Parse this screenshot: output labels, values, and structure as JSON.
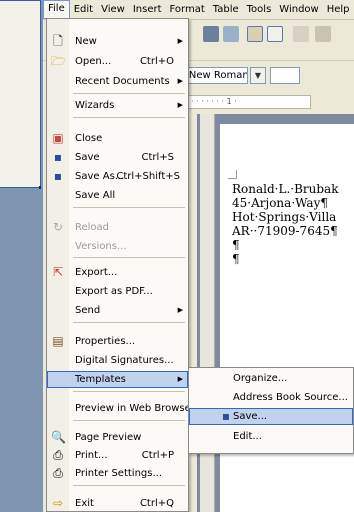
{
  "menubar": {
    "items": [
      "File",
      "Edit",
      "View",
      "Insert",
      "Format",
      "Table",
      "Tools",
      "Window",
      "Help"
    ]
  },
  "toolbar": {
    "font_name": "Times New Roman",
    "font_size": ""
  },
  "ruler": {
    "text": "· · · · · · · 1 ·"
  },
  "document": {
    "lines": [
      "Ronald·L.·Brubak",
      "45·Arjona·Way¶",
      "Hot·Springs·Villa",
      "AR··71909-7645¶",
      "¶",
      "¶"
    ]
  },
  "file_menu": {
    "new": {
      "label": "New"
    },
    "open": {
      "label": "Open...",
      "shortcut": "Ctrl+O"
    },
    "recent": {
      "label": "Recent Documents"
    },
    "wizards": {
      "label": "Wizards"
    },
    "close": {
      "label": "Close"
    },
    "save": {
      "label": "Save",
      "shortcut": "Ctrl+S"
    },
    "save_as": {
      "label": "Save As...",
      "shortcut": "Ctrl+Shift+S"
    },
    "save_all": {
      "label": "Save All"
    },
    "reload": {
      "label": "Reload"
    },
    "versions": {
      "label": "Versions..."
    },
    "export": {
      "label": "Export..."
    },
    "export_pdf": {
      "label": "Export as PDF..."
    },
    "send": {
      "label": "Send"
    },
    "properties": {
      "label": "Properties..."
    },
    "digital_signatures": {
      "label": "Digital Signatures..."
    },
    "templates": {
      "label": "Templates"
    },
    "preview_web": {
      "label": "Preview in Web Browser"
    },
    "page_preview": {
      "label": "Page Preview"
    },
    "print": {
      "label": "Print...",
      "shortcut": "Ctrl+P"
    },
    "printer_settings": {
      "label": "Printer Settings..."
    },
    "exit": {
      "label": "Exit",
      "shortcut": "Ctrl+Q"
    }
  },
  "templates_submenu": {
    "organize": {
      "label": "Organize..."
    },
    "address_book": {
      "label": "Address Book Source..."
    },
    "save": {
      "label": "Save..."
    },
    "edit": {
      "label": "Edit..."
    }
  },
  "colors": {
    "highlight": "#c1d2ee",
    "highlight_border": "#316ac5",
    "menu_bg": "#fbfaf6",
    "chrome": "#ece9d8"
  }
}
